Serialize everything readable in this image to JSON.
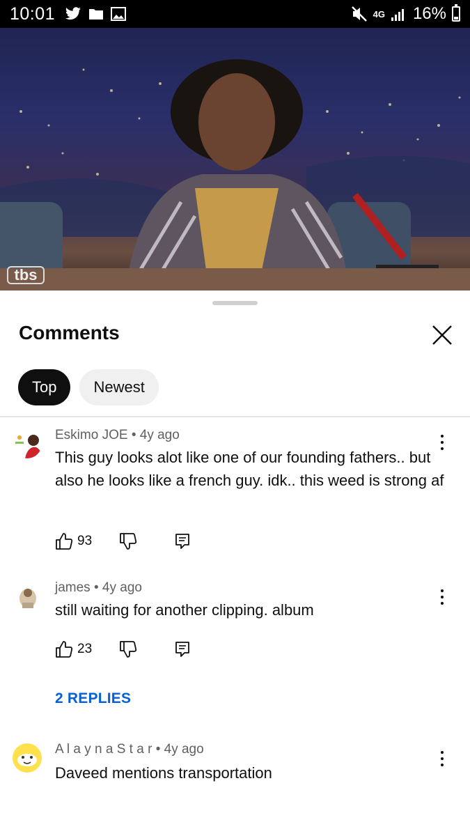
{
  "status_bar": {
    "time": "10:01",
    "network": "4G",
    "battery_percent": "16%",
    "icons": [
      "twitter-icon",
      "folder-icon",
      "image-icon",
      "mute-icon",
      "signal-icon",
      "battery-icon"
    ]
  },
  "video": {
    "watermark": "tbs",
    "progress_fraction": 0.62
  },
  "comments_panel": {
    "title": "Comments",
    "sort_chips": [
      {
        "label": "Top",
        "selected": true
      },
      {
        "label": "Newest",
        "selected": false
      }
    ],
    "comments": [
      {
        "author": "Eskimo JOE",
        "age": "4y ago",
        "text": "This guy looks alot like one of our founding fathers.. but also he looks like a french guy. idk.. this weed is strong af",
        "likes": "93"
      },
      {
        "author": "james",
        "age": "4y ago",
        "text": "still waiting for another clipping. album",
        "likes": "23",
        "replies_label": "2 REPLIES"
      },
      {
        "author": "A l a y n a S t a r",
        "age": "4y ago",
        "text": "Daveed mentions transportation"
      }
    ]
  },
  "colors": {
    "accent_link": "#065fd4",
    "progress": "#ff0000",
    "chip_active": "#0f0f0f",
    "chip_inactive": "#f0f0f0"
  }
}
